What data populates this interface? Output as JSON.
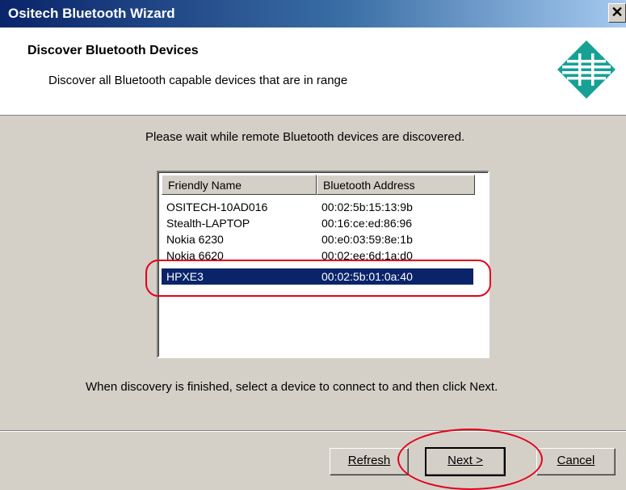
{
  "window": {
    "title": "Ositech Bluetooth Wizard",
    "close_glyph": "✕"
  },
  "header": {
    "title": "Discover Bluetooth Devices",
    "subtitle": "Discover all Bluetooth capable devices that are in range",
    "logo_icon": "ositech-logo-icon"
  },
  "main": {
    "prompt": "Please wait while remote Bluetooth devices are discovered.",
    "instruction": "When discovery is finished, select a device to connect to and then click Next."
  },
  "device_list": {
    "columns": [
      "Friendly Name",
      "Bluetooth Address"
    ],
    "rows": [
      {
        "name": "OSITECH-10AD016",
        "address": "00:02:5b:15:13:9b"
      },
      {
        "name": "Stealth-LAPTOP",
        "address": "00:16:ce:ed:86:96"
      },
      {
        "name": "Nokia 6230",
        "address": "00:e0:03:59:8e:1b"
      },
      {
        "name": "Nokia 6620",
        "address": "00:02:ee:6d:1a:d0"
      },
      {
        "name": "HPXE3",
        "address": "00:02:5b:01:0a:40"
      }
    ],
    "selected_index": 4
  },
  "buttons": {
    "refresh": "Refresh",
    "next": "Next >",
    "cancel": "Cancel"
  },
  "colors": {
    "title_bar": "#0a246a",
    "selection": "#0a246a",
    "annotation": "#e3001b"
  }
}
